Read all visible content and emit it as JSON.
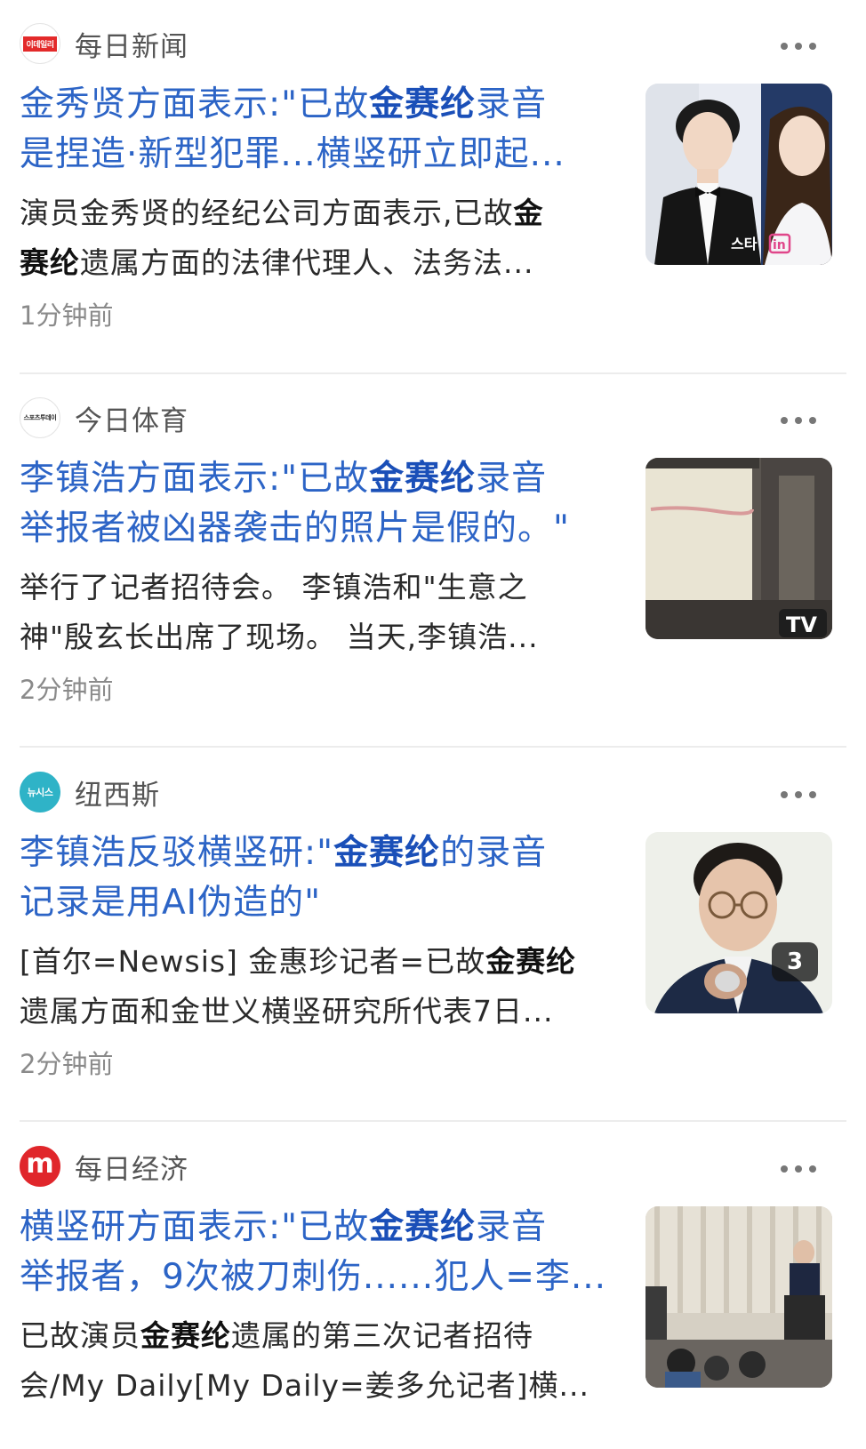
{
  "articles": [
    {
      "source": "每日新闻",
      "logo_text": "이데일리",
      "title_line1": [
        "金秀贤方面表示:\"已故",
        "金赛纶",
        "录音"
      ],
      "title_line2": "是捏造·新型犯罪...横竖研立即起...",
      "body_line1": [
        "演员金秀贤的经纪公司方面表示,已故",
        "金"
      ],
      "body_line2": [
        "赛纶",
        "遗属方面的法律代理人、法务法..."
      ],
      "time": "1分钟前",
      "thumb_icon": "photo-two-actors",
      "thumb_text": "스타",
      "thumb_text2": "in"
    },
    {
      "source": "今日体育",
      "logo_text": "스포츠투데이",
      "title_line1": [
        "李镇浩方面表示:\"已故",
        "金赛纶",
        "录音"
      ],
      "title_line2": "举报者被凶器袭击的照片是假的。\"",
      "body_line1": "举行了记者招待会。 李镇浩和\"生意之",
      "body_line2": "神\"殷玄长出席了现场。 当天,李镇浩...",
      "time": "2分钟前",
      "thumb_icon": "photo-projection-screen",
      "thumb_text": "TV"
    },
    {
      "source": "纽西斯",
      "logo_text": "뉴시스",
      "title_line1": [
        "李镇浩反驳横竖研:\"",
        "金赛纶",
        "的录音"
      ],
      "title_line2": "记录是用AI伪造的\"",
      "body_line1": [
        "[首尔=Newsis] 金惠珍记者=已故",
        "金赛纶"
      ],
      "body_line2": "遗属方面和金世义横竖研究所代表7日...",
      "time": "2分钟前",
      "thumb_icon": "photo-man-speaking",
      "badge": "3"
    },
    {
      "source": "每日经济",
      "logo_text": "m",
      "title_line1": [
        "横竖研方面表示:\"已故",
        "金赛纶",
        "录音"
      ],
      "title_line2": "举报者，9次被刀刺伤......犯人=李...",
      "body_line1": [
        "已故演员",
        "金赛纶",
        "遗属的第三次记者招待"
      ],
      "body_line2": "会/My Daily[My Daily=姜多允记者]横...",
      "thumb_icon": "photo-press-conference"
    }
  ],
  "colors": {
    "title": "#2c64c6",
    "highlight": "#1a4fb8",
    "time": "#8a8a8a"
  }
}
